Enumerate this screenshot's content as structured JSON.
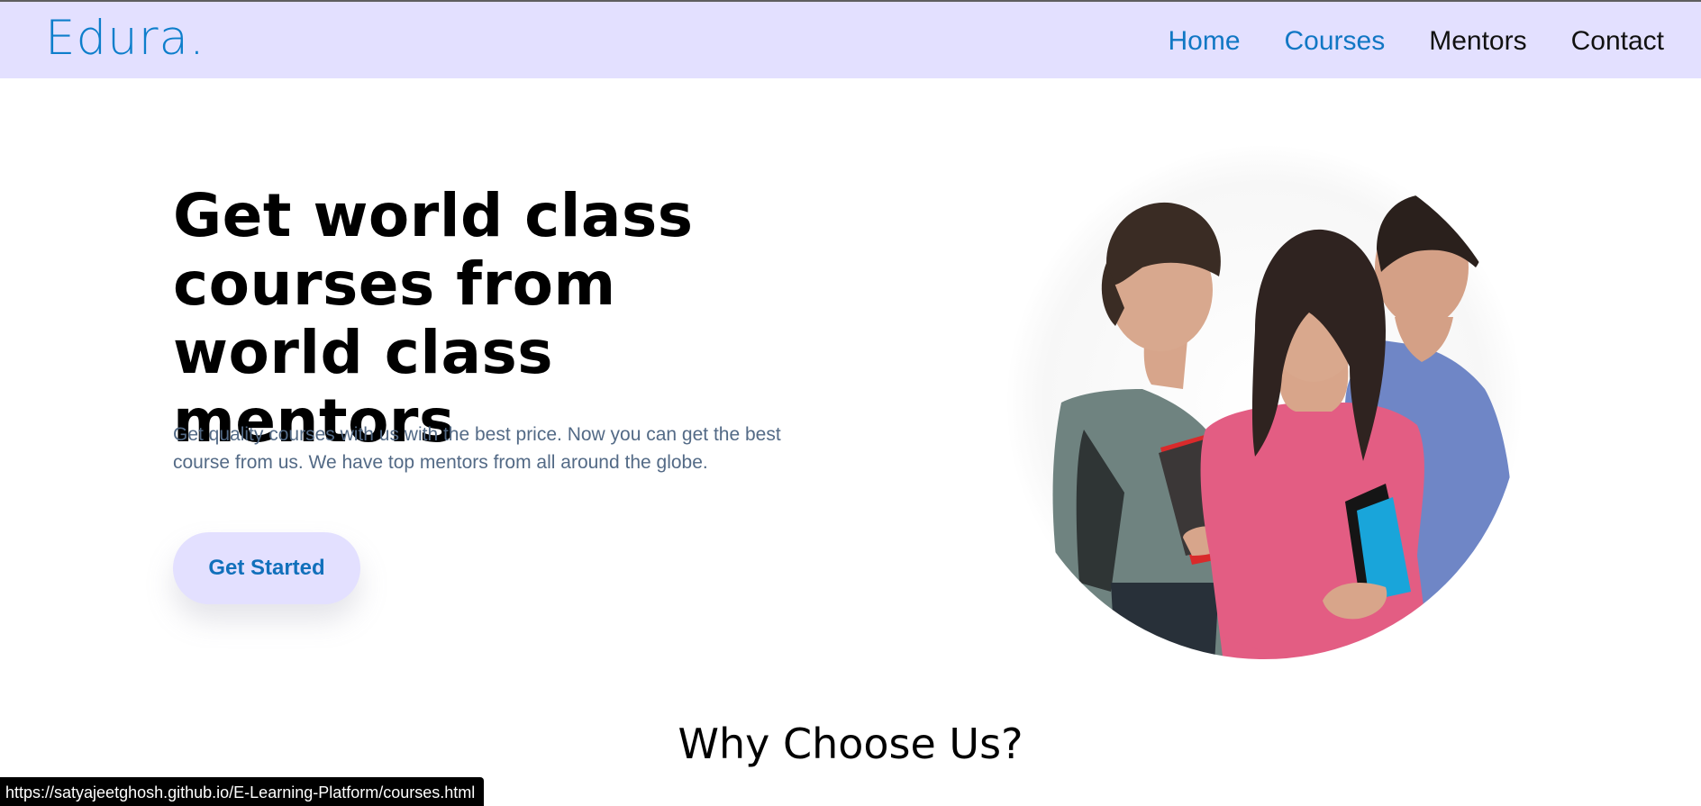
{
  "header": {
    "logo": "Edura.",
    "nav": [
      {
        "label": "Home",
        "active": true
      },
      {
        "label": "Courses",
        "active": true
      },
      {
        "label": "Mentors",
        "active": false
      },
      {
        "label": "Contact",
        "active": false
      }
    ]
  },
  "hero": {
    "title": "Get world class courses from world class mentors",
    "description": "Get quality courses with us with the best price. Now you can get the best course from us. We have top mentors from all around the globe.",
    "cta_label": "Get Started"
  },
  "section": {
    "title": "Why Choose Us?"
  },
  "status_bar": {
    "url": "https://satyajeetghosh.github.io/E-Learning-Platform/courses.html"
  },
  "colors": {
    "header_bg": "#e3e0ff",
    "brand_blue": "#0d7ecb",
    "cta_bg": "#e3e0ff",
    "description_text": "#536a86"
  }
}
